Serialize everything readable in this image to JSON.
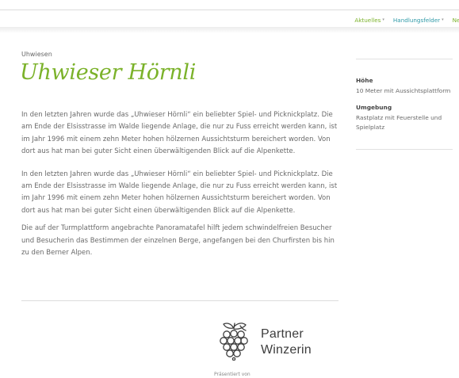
{
  "nav": {
    "items": [
      {
        "label": "Aktuelles",
        "caret": "▾"
      },
      {
        "label": "Handlungsfelder",
        "caret": "▾"
      },
      {
        "label": "Neu"
      }
    ]
  },
  "breadcrumb": "Uhwiesen",
  "title": "Uhwieser Hörnli",
  "paragraphs": [
    "In den letzten Jahren wurde das „Uhwieser Hörnli“ ein beliebter Spiel- und Picknickplatz. Die am Ende der Elsisstrasse im Walde liegende Anlage, die nur zu Fuss erreicht werden kann, ist im Jahr 1996 mit einem zehn Meter hohen hölzernen Aussichtsturm bereichert worden. Von dort aus hat man bei guter Sicht einen überwältigenden Blick auf die Alpenkette.",
    "In den letzten Jahren wurde das „Uhwieser Hörnli“ ein beliebter Spiel- und Picknickplatz. Die am Ende der Elsisstrasse im Walde liegende Anlage, die nur zu Fuss erreicht werden kann, ist im Jahr 1996 mit einem zehn Meter hohen hölzernen Aussichtsturm bereichert worden. Von dort aus hat man bei guter Sicht einen überwältigenden Blick auf die Alpenkette.",
    "Die auf der Turmplattform angebrachte Panoramatafel hilft jedem schwindel­freien Besucher und Besucherin das Bestimmen der einzelnen Berge, ange­fangen bei den Churfirsten bis hin zu den Berner Alpen."
  ],
  "sidebar": {
    "facts": [
      {
        "label": "Höhe",
        "value": "10 Meter mit Aussichts­plattform"
      },
      {
        "label": "Umgebung",
        "value": "Rastplatz mit Feuerstelle und Spielplatz"
      }
    ]
  },
  "partner": {
    "line1": "Partner",
    "line2": "Winzerin",
    "icon": "grape-icon"
  },
  "presented": "Präsentiert von",
  "colors": {
    "accent_green": "#7bb22a",
    "accent_teal": "#2f9aa8"
  }
}
